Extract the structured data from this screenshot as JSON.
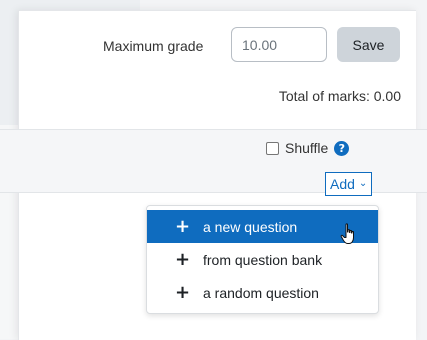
{
  "grade": {
    "label": "Maximum grade",
    "value": "10.00",
    "save_label": "Save",
    "total_marks": "Total of marks: 0.00"
  },
  "section": {
    "shuffle_label": "Shuffle",
    "help_symbol": "?",
    "add_label": "Add",
    "add_chevron": "⌄"
  },
  "menu": {
    "items": [
      {
        "icon": "+",
        "label": "a new question",
        "active": true
      },
      {
        "icon": "+",
        "label": "from question bank",
        "active": false
      },
      {
        "icon": "+",
        "label": "a random question",
        "active": false
      }
    ]
  },
  "colors": {
    "accent": "#0f6cbf",
    "save_bg": "#ced4da"
  },
  "icons": {
    "help": "help-icon",
    "plus": "plus-icon",
    "chevron": "chevron-down-icon",
    "pointer": "hand-cursor-icon"
  }
}
